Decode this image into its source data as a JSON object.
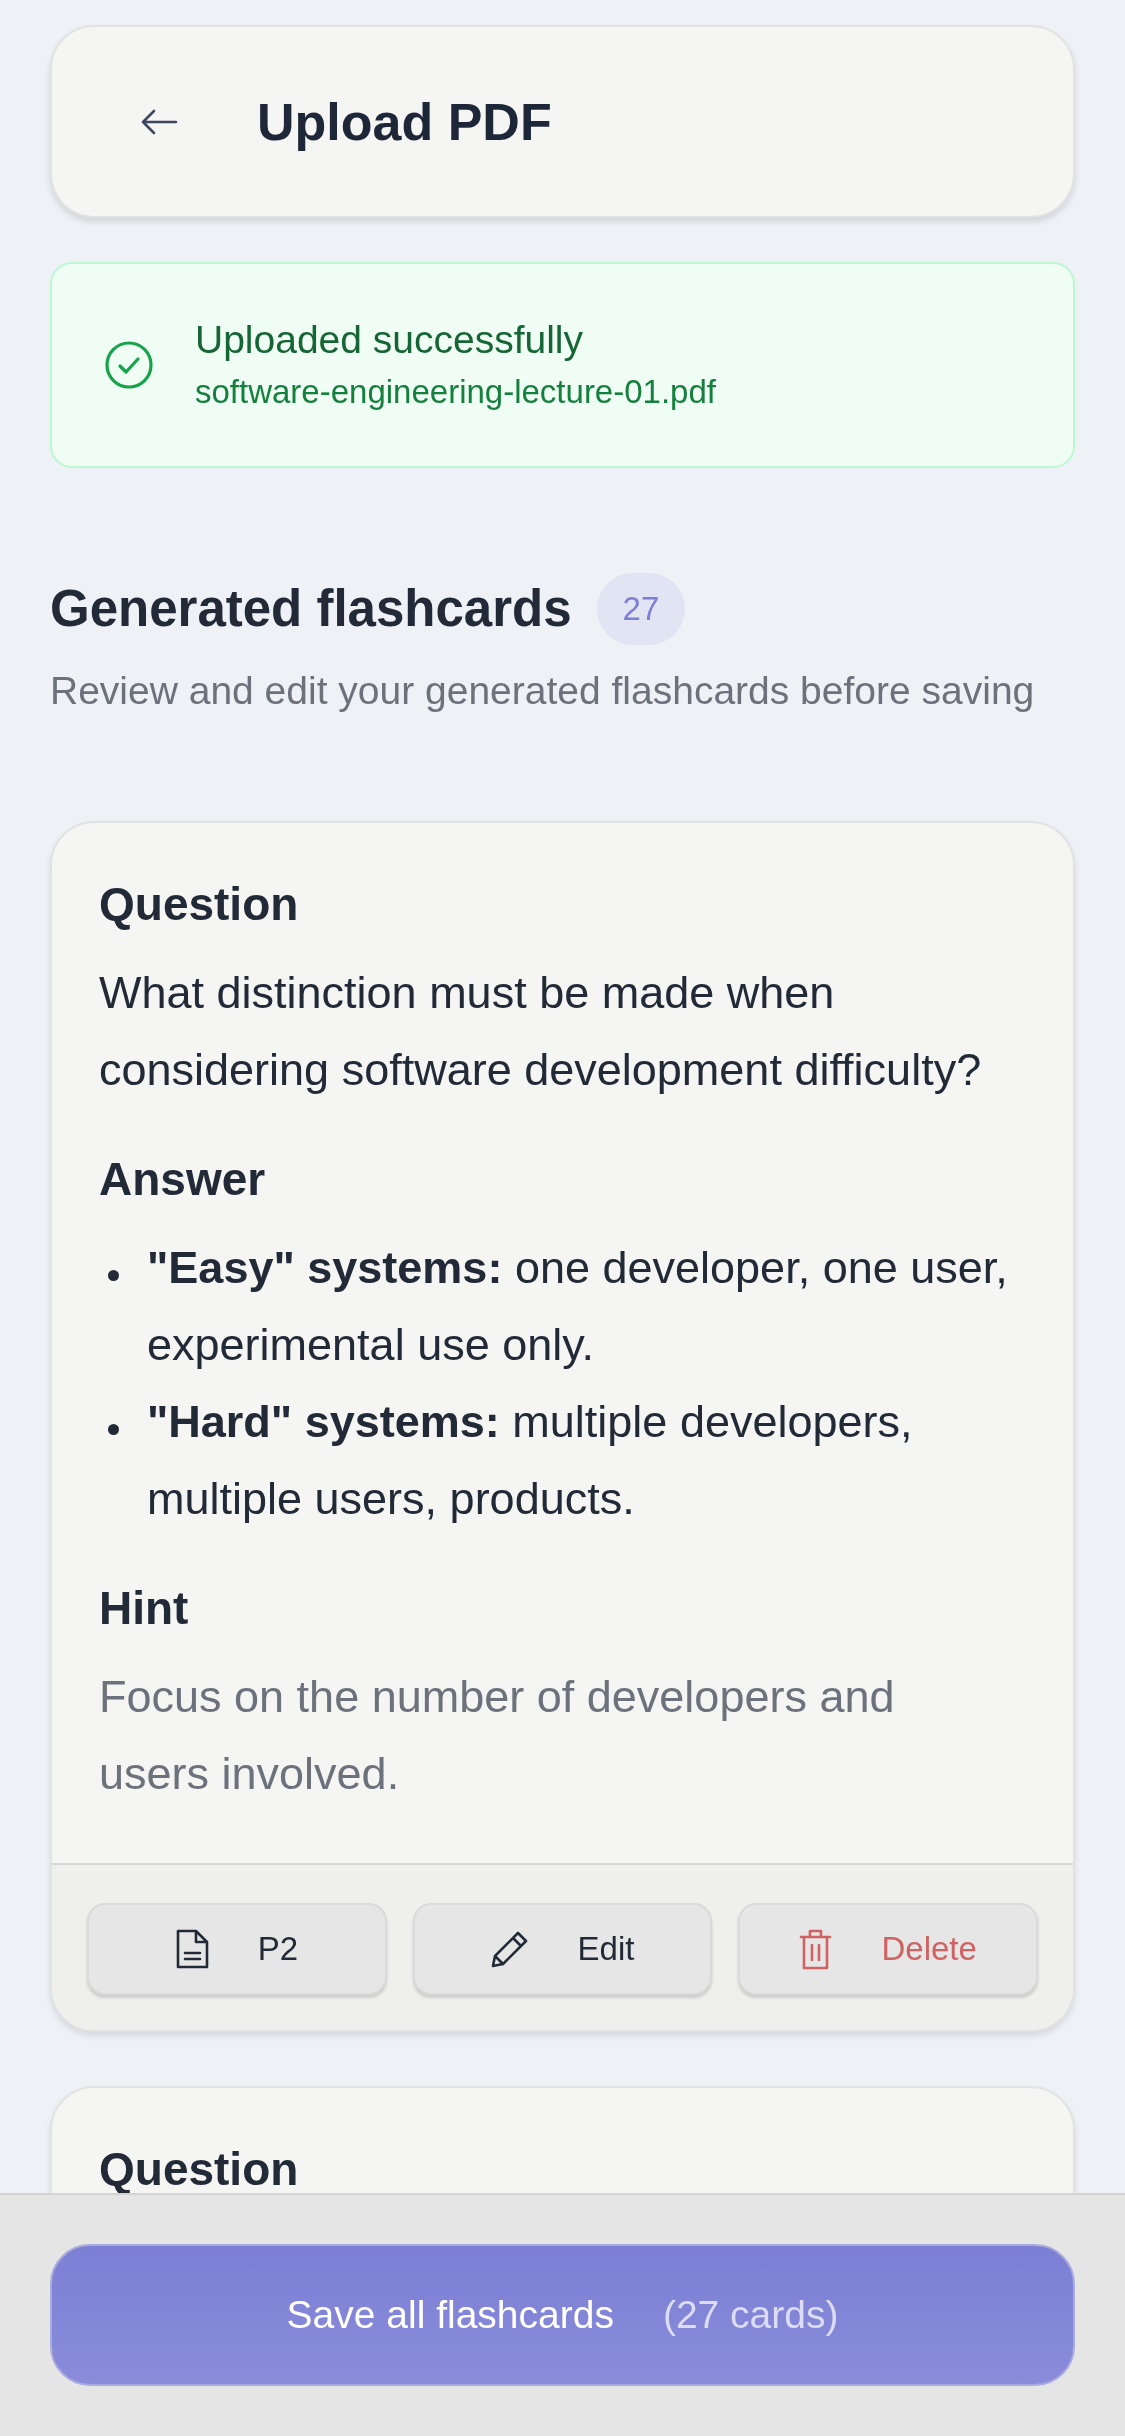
{
  "header": {
    "title": "Upload PDF"
  },
  "upload_status": {
    "kind": "success",
    "title": "Uploaded successfully",
    "file_name": "software-engineering-lecture-01.pdf"
  },
  "section": {
    "title": "Generated flashcards",
    "count": "27",
    "subtitle": "Review and edit your generated flashcards before saving"
  },
  "flashcards": [
    {
      "question_label": "Question",
      "question": "What distinction must be made when considering software development difficulty?",
      "answer_label": "Answer",
      "answer_items": [
        "**\"Easy\" systems:** one developer, one user, experimental use only.",
        "**\"Hard\" systems:** multiple developers, multiple users, products."
      ],
      "hint_label": "Hint",
      "hint": "Focus on the number of developers and users involved.",
      "actions": [
        {
          "kind": "page",
          "label": "P2"
        },
        {
          "kind": "edit",
          "label": "Edit"
        },
        {
          "kind": "delete",
          "label": "Delete"
        }
      ]
    },
    {
      "question_label": "Question"
    }
  ],
  "save_button": {
    "label": "Save all flashcards",
    "count": "(27 cards)"
  }
}
